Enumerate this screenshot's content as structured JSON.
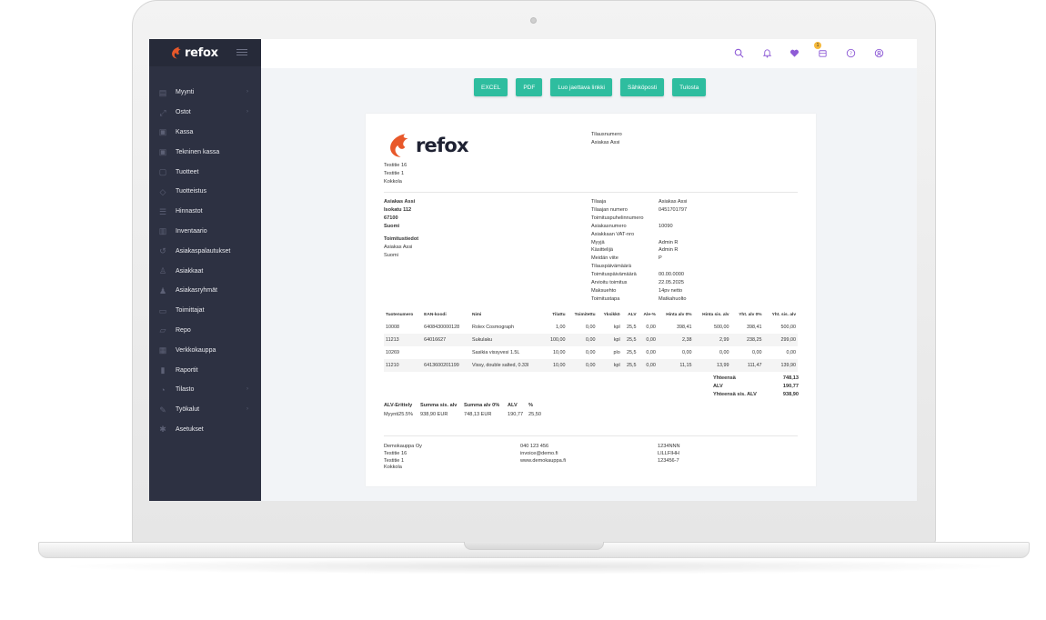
{
  "brand": {
    "name": "refox",
    "flame_color": "#e8582a",
    "accent": "#2ebd9f",
    "sidebar_bg": "#2d3142"
  },
  "sidebar": {
    "items": [
      {
        "label": "Myynti",
        "icon": "cart-icon",
        "has_children": true
      },
      {
        "label": "Ostot",
        "icon": "arrows-icon",
        "has_children": true
      },
      {
        "label": "Kassa",
        "icon": "register-icon",
        "has_children": false
      },
      {
        "label": "Tekninen kassa",
        "icon": "register-icon",
        "has_children": false
      },
      {
        "label": "Tuotteet",
        "icon": "box-icon",
        "has_children": false
      },
      {
        "label": "Tuotteistus",
        "icon": "tag-icon",
        "has_children": false
      },
      {
        "label": "Hinnastot",
        "icon": "price-list-icon",
        "has_children": false
      },
      {
        "label": "Inventaario",
        "icon": "inventory-icon",
        "has_children": false
      },
      {
        "label": "Asiakaspalautukset",
        "icon": "return-icon",
        "has_children": false
      },
      {
        "label": "Asiakkaat",
        "icon": "user-icon",
        "has_children": false
      },
      {
        "label": "Asiakasryhmät",
        "icon": "users-icon",
        "has_children": false
      },
      {
        "label": "Toimittajat",
        "icon": "truck-icon",
        "has_children": false
      },
      {
        "label": "Repo",
        "icon": "folder-icon",
        "has_children": false
      },
      {
        "label": "Verkkokauppa",
        "icon": "store-icon",
        "has_children": false
      },
      {
        "label": "Raportit",
        "icon": "chart-icon",
        "has_children": false
      },
      {
        "label": "Tilasto",
        "icon": "stats-icon",
        "has_children": true
      },
      {
        "label": "Työkalut",
        "icon": "wrench-icon",
        "has_children": true
      },
      {
        "label": "Asetukset",
        "icon": "gear-icon",
        "has_children": false
      }
    ]
  },
  "topbar": {
    "cart_badge": "1"
  },
  "actions": {
    "excel": "EXCEL",
    "pdf": "PDF",
    "share": "Luo jaettava linkki",
    "email": "Sähköposti",
    "print": "Tulosta"
  },
  "doc": {
    "seller_address": [
      "Testitie 16",
      "Testitie 1",
      "Kokkola"
    ],
    "order_header": [
      "Tilausnumero",
      "Asiakas Assi"
    ],
    "buyer": {
      "name": "Asiakas Assi",
      "street": "Isokatu 112",
      "zip": "67100",
      "country": "Suomi"
    },
    "delivery_title": "Toimitustiedot",
    "delivery": [
      "Asiakas Assi",
      "Suomi"
    ],
    "meta_labels": [
      "Tilaaja",
      "Tilaajan numero",
      "Toimituspuhelinnumero",
      "Asiakasnumero",
      "Asiakkaan VAT-nro",
      "Myyjä",
      "Käsittelijä",
      "Meidän viite",
      "Tilauspäivämäärä",
      "Toimituspäivämäärä",
      "Arvioitu toimitus",
      "Maksuehto",
      "Toimitustapa"
    ],
    "meta_values": [
      "Asiakas Assi",
      "0451701797",
      "",
      "10090",
      "",
      "Admin R",
      "Admin R",
      "P",
      "",
      "00.00.0000",
      "22.05.2025",
      "14pv netto",
      "Matkahuolto"
    ],
    "columns": [
      "Tuotenumero",
      "EAN-koodi",
      "Nimi",
      "Tilattu",
      "Toimitettu",
      "Yksikkö",
      "ALV",
      "Ale-%",
      "Hinta alv 0%",
      "Hinta sis. alv",
      "Yht. alv 0%",
      "Yht. sis. alv"
    ],
    "rows": [
      [
        "10008",
        "6408430000128",
        "Rolex Cosmograph",
        "1,00",
        "0,00",
        "kpl",
        "25,5",
        "0,00",
        "398,41",
        "500,00",
        "398,41",
        "500,00"
      ],
      [
        "11213",
        "64016627",
        "Sukulaku",
        "100,00",
        "0,00",
        "kpl",
        "25,5",
        "0,00",
        "2,38",
        "2,99",
        "238,25",
        "299,00"
      ],
      [
        "10269",
        "",
        "Sasikia vissyvesi 1.5L",
        "10,00",
        "0,00",
        "plo",
        "25,5",
        "0,00",
        "0,00",
        "0,00",
        "0,00",
        "0,00"
      ],
      [
        "11210",
        "6413600201199",
        "Vissy, double salted, 0.33l",
        "10,00",
        "0,00",
        "kpl",
        "25,5",
        "0,00",
        "11,15",
        "13,99",
        "111,47",
        "139,90"
      ]
    ],
    "totals": [
      {
        "label": "Yhteensä",
        "value": "748,13"
      },
      {
        "label": "ALV",
        "value": "190,77"
      },
      {
        "label": "Yhteensä sis. ALV",
        "value": "938,90"
      }
    ],
    "vat_headers": [
      "ALV-Erittely",
      "Summa sis. alv",
      "Summa alv 0%",
      "ALV",
      "%"
    ],
    "vat_row": [
      "Myynti25.5%",
      "938,90 EUR",
      "748,13 EUR",
      "190,77",
      "25,50"
    ],
    "footer_company": [
      "Demokauppa Oy",
      "Testitie 16",
      "Testitie 1",
      "Kokkola"
    ],
    "footer_contact": [
      "040 123 456",
      "invoice@demo.fi",
      "www.demokauppa.fi"
    ],
    "footer_ids": [
      "1234NNN",
      "LILLFIHH",
      "123456-7"
    ]
  }
}
